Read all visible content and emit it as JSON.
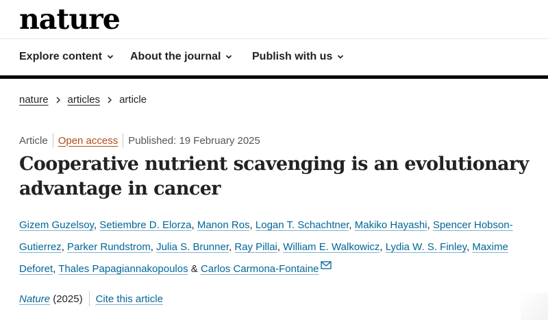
{
  "brand": {
    "logo": "nature"
  },
  "nav": {
    "items": [
      {
        "label": "Explore content"
      },
      {
        "label": "About the journal"
      },
      {
        "label": "Publish with us"
      }
    ]
  },
  "breadcrumb": {
    "items": [
      "nature",
      "articles",
      "article"
    ]
  },
  "meta": {
    "type": "Article",
    "access": "Open access",
    "published": "Published: 19 February 2025"
  },
  "article": {
    "title": "Cooperative nutrient scavenging is an evolutionary advantage in cancer"
  },
  "authors": {
    "list": [
      "Gizem Guzelsoy",
      "Setiembre D. Elorza",
      "Manon Ros",
      "Logan T. Schachtner",
      "Makiko Hayashi",
      "Spencer Hobson-Gutierrez",
      "Parker Rundstrom",
      "Julia S. Brunner",
      "Ray Pillai",
      "William E. Walkowicz",
      "Lydia W. S. Finley",
      "Maxime Deforet",
      "Thales Papagiannakopoulos",
      "Carlos Carmona-Fontaine"
    ],
    "separator": ", ",
    "last_separator": " & "
  },
  "citation": {
    "journal": "Nature",
    "year": " (2025)",
    "cite_link": "Cite this article"
  },
  "colors": {
    "link": "#006699",
    "open_access": "#b04a19",
    "rule": "#000000"
  }
}
